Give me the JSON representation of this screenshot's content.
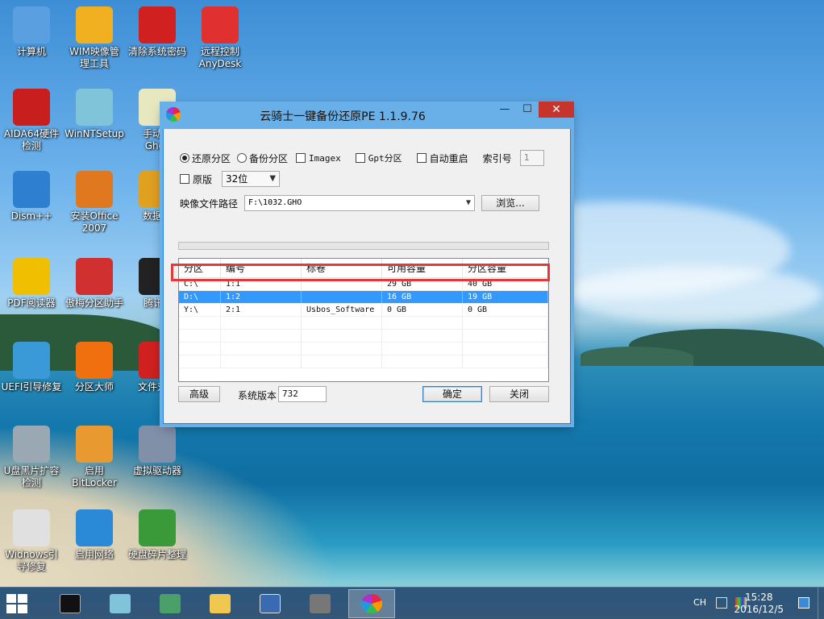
{
  "desktop": {
    "icons": [
      {
        "name": "computer",
        "label": "计算机",
        "color": "#5aa0e0"
      },
      {
        "name": "wim-manager",
        "label": "WIM映像管\n理工具",
        "color": "#f0b020"
      },
      {
        "name": "clear-password",
        "label": "清除系统密码",
        "color": "#d02020"
      },
      {
        "name": "anydesk",
        "label": "远程控制\nAnyDesk",
        "color": "#e03030"
      },
      {
        "name": "aida64",
        "label": "AIDA64硬件\n检测",
        "color": "#c81e1e"
      },
      {
        "name": "winntsetup",
        "label": "WinNTSetup",
        "color": "#7fc4d8"
      },
      {
        "name": "ghost",
        "label": "手动运\nGhos",
        "color": "#e8e8c0"
      },
      {
        "name": "dism",
        "label": "Dism++",
        "color": "#2f7fd0"
      },
      {
        "name": "office2007",
        "label": "安装Office\n2007",
        "color": "#e07820"
      },
      {
        "name": "data-recovery",
        "label": "数据恢",
        "color": "#e0a020"
      },
      {
        "name": "pdf-reader",
        "label": "PDF阅读器",
        "color": "#f0c000"
      },
      {
        "name": "partition-assistant",
        "label": "傲梅分区助手",
        "color": "#d03030"
      },
      {
        "name": "tencent",
        "label": "腾讯Q",
        "color": "#222222"
      },
      {
        "name": "uefi-repair",
        "label": "UEFI引导修复",
        "color": "#3a9ad8"
      },
      {
        "name": "diskgenius",
        "label": "分区大师",
        "color": "#f07010"
      },
      {
        "name": "file-compare",
        "label": "文件对比",
        "color": "#d02020"
      },
      {
        "name": "usb-check",
        "label": "U盘黑片扩容\n检测",
        "color": "#9aa8b4"
      },
      {
        "name": "bitlocker",
        "label": "启用\nBitLocker",
        "color": "#e89a30"
      },
      {
        "name": "virtual-drive",
        "label": "虚拟驱动器",
        "color": "#8090a8"
      },
      {
        "name": "windows-repair",
        "label": "Widnows引\n导修复",
        "color": "#e0e0e0"
      },
      {
        "name": "network",
        "label": "启用网络",
        "color": "#2a8ad8"
      },
      {
        "name": "defrag",
        "label": "硬盘碎片整理",
        "color": "#3a9a3a"
      }
    ]
  },
  "window": {
    "title": "云骑士一键备份还原PE 1.1.9.76",
    "min": "—",
    "max": "☐",
    "close": "✕",
    "options": {
      "restore": "还原分区",
      "backup": "备份分区",
      "imagex": "Imagex",
      "gpt": "Gpt分区",
      "auto_restart": "自动重启",
      "index_label": "索引号",
      "index_value": "1",
      "original": "原版",
      "bits": "32位"
    },
    "image_path_label": "映像文件路径",
    "image_path_value": "F:\\1032.GHO",
    "browse": "浏览...",
    "table": {
      "headers": [
        "分区",
        "编号",
        "标卷",
        "可用容量",
        "分区容量"
      ],
      "rows": [
        [
          "C:\\",
          "1:1",
          "",
          "29 GB",
          "40 GB"
        ],
        [
          "D:\\",
          "1:2",
          "",
          "16 GB",
          "19 GB"
        ],
        [
          "Y:\\",
          "2:1",
          "Usbos_Software",
          "0 GB",
          "0 GB"
        ]
      ],
      "selected_index": 1
    },
    "advanced": "高级",
    "sys_version_label": "系统版本",
    "sys_version_value": "732",
    "ok": "确定",
    "close_btn": "关闭"
  },
  "taskbar": {
    "lang": "CH",
    "time": "15:28",
    "date": "2016/12/5"
  }
}
